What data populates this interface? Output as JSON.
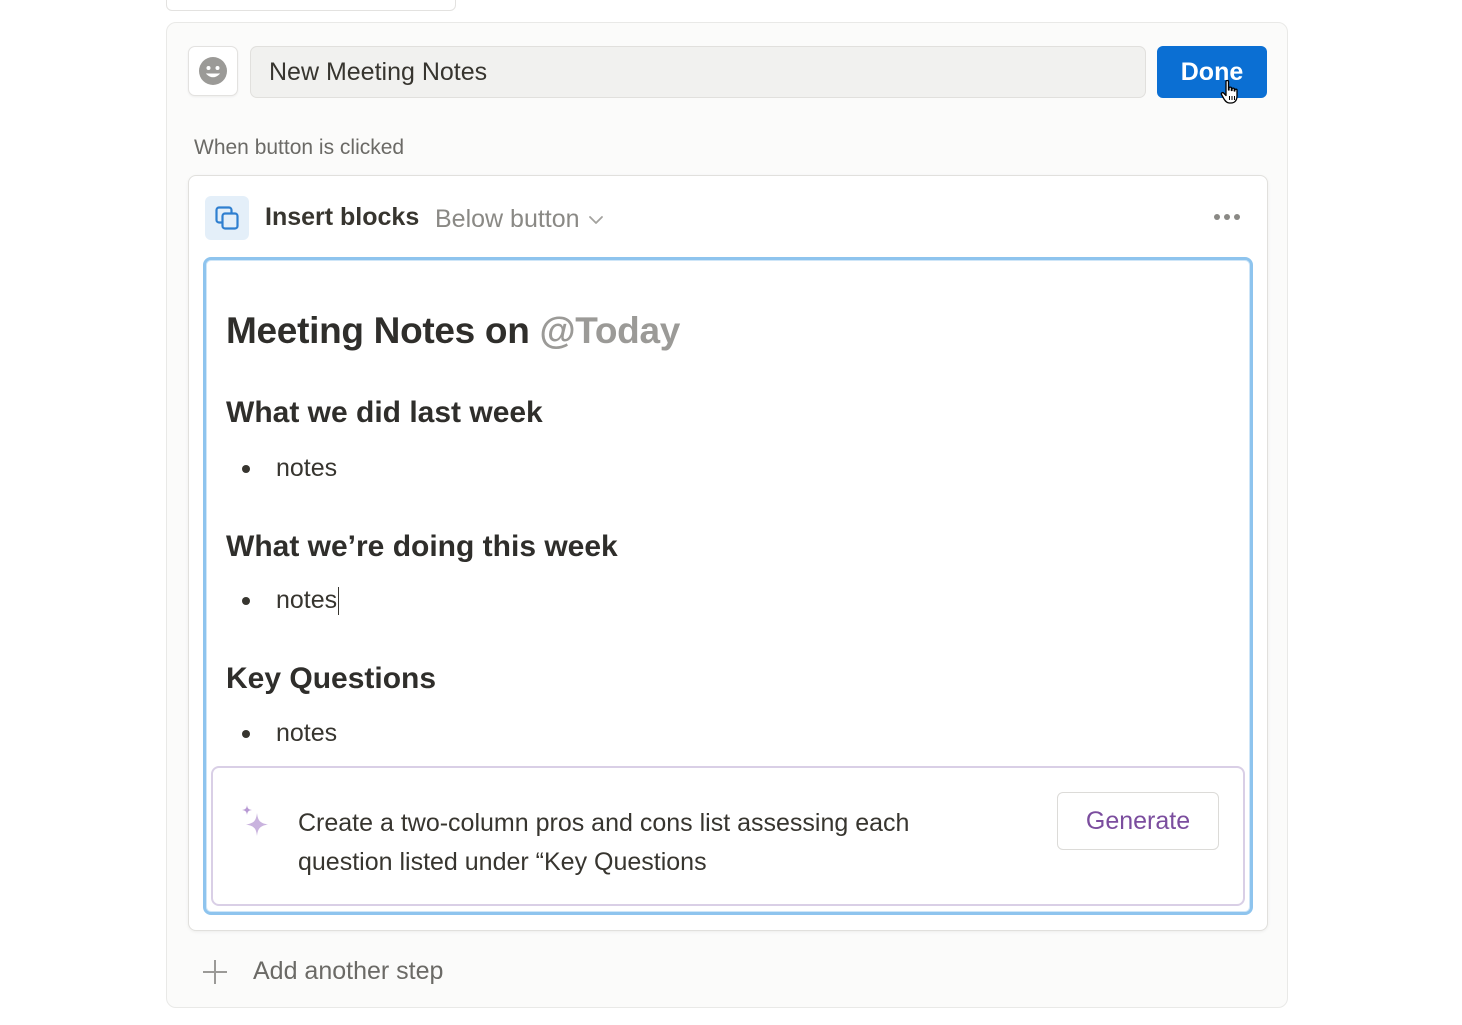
{
  "button_editor": {
    "emoji_icon": "smiley-face-icon",
    "name_value": "New Meeting Notes",
    "done_label": "Done",
    "when_label": "When button is clicked"
  },
  "step": {
    "icon": "duplicate-blocks-icon",
    "title": "Insert blocks",
    "position_label": "Below button",
    "more_icon": "ellipsis-icon"
  },
  "content": {
    "title_prefix": "Meeting Notes on",
    "title_mention": "@Today",
    "sections": [
      {
        "heading": "What we did last week",
        "bullet": "notes"
      },
      {
        "heading": "What we’re doing this week",
        "bullet": "notes"
      },
      {
        "heading": "Key Questions",
        "bullet": "notes"
      }
    ]
  },
  "ai_block": {
    "icon": "sparkle-icon",
    "prompt_line1": "Create a two-column pros and cons list assessing each",
    "prompt_line2": "question listed under “Key Questions",
    "generate_label": "Generate"
  },
  "footer": {
    "add_icon": "plus-icon",
    "add_step_label": "Add another step"
  },
  "colors": {
    "done_button": "#0b6fd3",
    "editor_focus_border": "#8ec4ee",
    "generate_text": "#7b4d9e",
    "ai_border": "#d9cfe6"
  }
}
